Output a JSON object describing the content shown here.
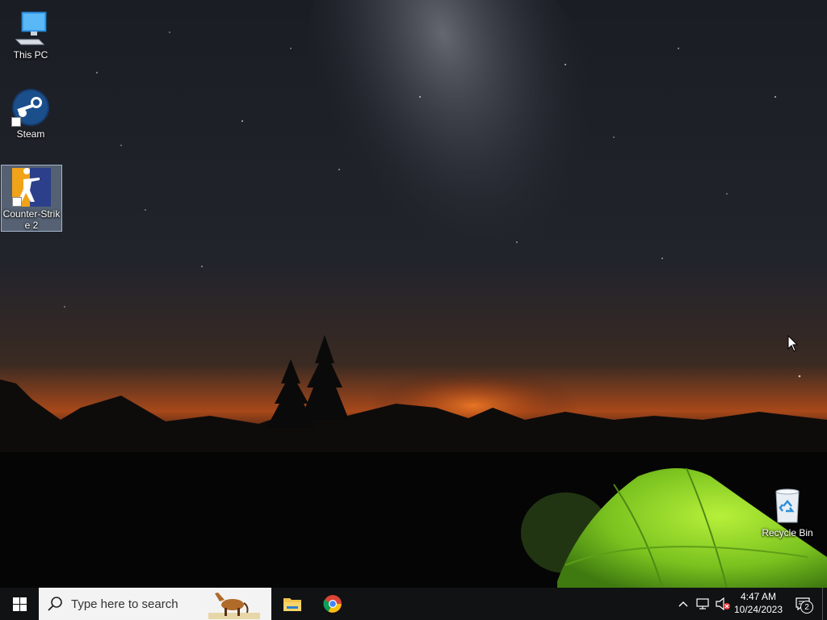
{
  "desktop": {
    "icons": [
      {
        "label": "This PC",
        "icon": "computer-icon"
      },
      {
        "label": "Steam",
        "icon": "steam-icon"
      },
      {
        "label": "Counter-Strik\ne 2",
        "icon": "counter-strike-icon",
        "selected": true
      },
      {
        "label": "Recycle Bin",
        "icon": "recycle-bin-icon"
      }
    ],
    "wallpaper": "night-sky-milky-way-tent"
  },
  "taskbar": {
    "start_icon": "windows-logo-icon",
    "search_placeholder": "Type here to search",
    "search_icon": "magnifier-icon",
    "pinned": [
      {
        "name": "File Explorer",
        "icon": "folder-icon"
      },
      {
        "name": "Google Chrome",
        "icon": "chrome-icon"
      }
    ],
    "tray": {
      "overflow_icon": "chevron-up-icon",
      "network_icon": "network-icon",
      "volume_icon": "volume-muted-icon",
      "time": "4:47 AM",
      "date": "10/24/2023",
      "notification_count": "2"
    }
  },
  "colors": {
    "taskbar": "#101214",
    "selection": "#96afcd",
    "tent": "#8ed626",
    "glow": "#e8671b"
  }
}
